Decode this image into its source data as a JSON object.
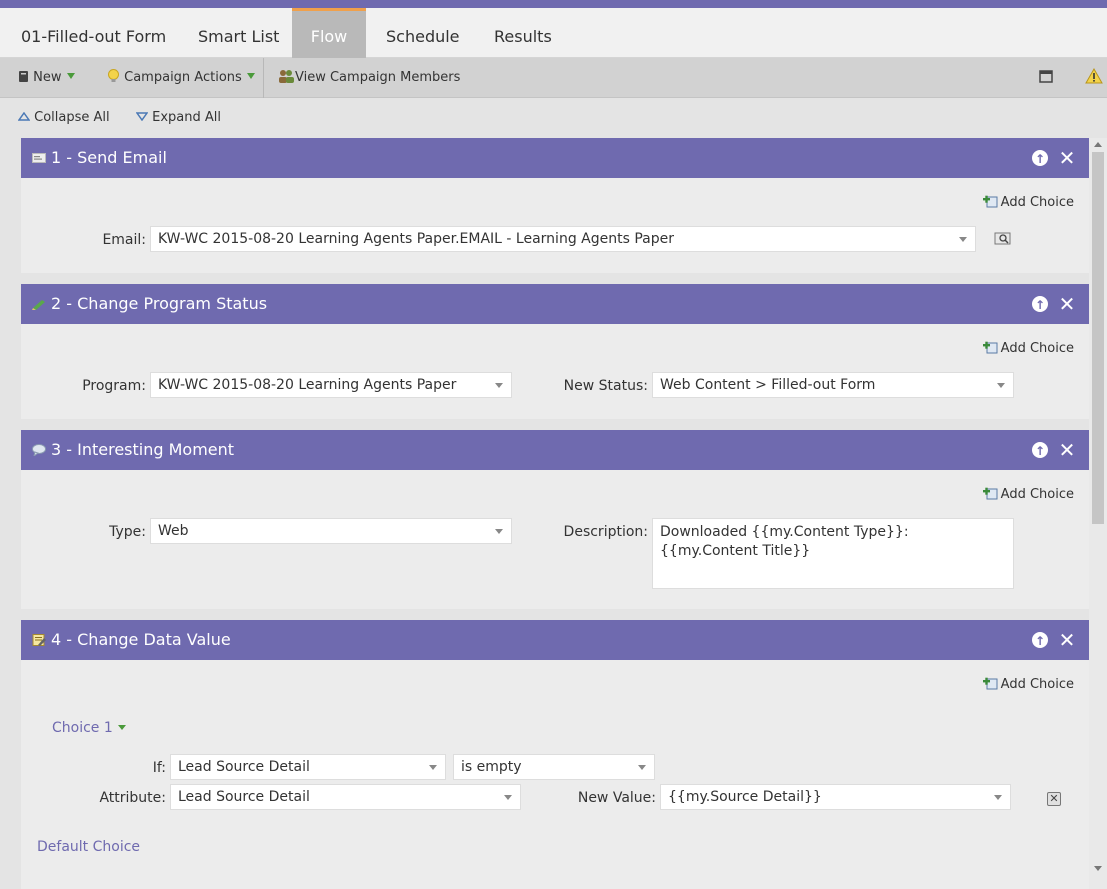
{
  "tabs": [
    {
      "label": "01-Filled-out Form"
    },
    {
      "label": "Smart List"
    },
    {
      "label": "Flow"
    },
    {
      "label": "Schedule"
    },
    {
      "label": "Results"
    }
  ],
  "toolbar": {
    "new_label": "New",
    "campaign_actions_label": "Campaign Actions",
    "view_members_label": "View Campaign Members"
  },
  "subbar": {
    "collapse_label": "Collapse All",
    "expand_label": "Expand All"
  },
  "add_choice_label": "Add Choice",
  "steps": [
    {
      "title": "1 - Send Email",
      "icon": "email-icon",
      "email_label": "Email:",
      "email_value": "KW-WC 2015-08-20 Learning Agents Paper.EMAIL - Learning Agents Paper"
    },
    {
      "title": "2 - Change Program Status",
      "icon": "status-icon",
      "program_label": "Program:",
      "program_value": "KW-WC 2015-08-20 Learning Agents Paper",
      "new_status_label": "New Status:",
      "new_status_value": "Web Content > Filled-out Form"
    },
    {
      "title": "3 - Interesting Moment",
      "icon": "speech-bubble-icon",
      "type_label": "Type:",
      "type_value": "Web",
      "description_label": "Description:",
      "description_value": "Downloaded {{my.Content Type}}: {{my.Content Title}}"
    },
    {
      "title": "4 - Change Data Value",
      "icon": "data-value-icon",
      "choice1_label": "Choice 1",
      "if_label": "If:",
      "if_value": "Lead Source Detail",
      "condition_value": "is empty",
      "attribute_label": "Attribute:",
      "attribute_value": "Lead Source Detail",
      "new_value_label": "New Value:",
      "new_value_value": "{{my.Source Detail}}",
      "default_choice_label": "Default Choice"
    }
  ],
  "colors": {
    "accent": "#6f6aaf",
    "tab_active": "#b9b9b9",
    "tab_active_border": "#f0a04b"
  }
}
